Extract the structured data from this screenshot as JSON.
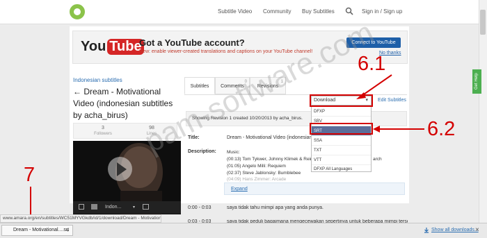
{
  "nav": {
    "links": [
      "Subtitle Video",
      "Community",
      "Buy Subtitles",
      "Sign in / Sign up"
    ]
  },
  "youtube_banner": {
    "logo_you": "You",
    "logo_tube": "Tube",
    "title": "Got a YouTube account?",
    "subtitle": "New: enable viewer-created translations and captions on your YouTube channel!",
    "connect_button": "Connect to YouTube",
    "no_thanks": "No thanks"
  },
  "video": {
    "language_link": "Indonesian subtitles",
    "title": "← Dream - Motivational Video (indonesian subtitles by acha_birus)",
    "followers_count": "3",
    "followers_label": "Followers",
    "lines_count": "98",
    "lines_label": "Lines",
    "bar_text": "Indon..."
  },
  "tabs": [
    {
      "label": "Subtitles",
      "count": ""
    },
    {
      "label": "Comments",
      "count": "0"
    },
    {
      "label": "Revisions",
      "count": "1"
    }
  ],
  "download": {
    "selected": "Download",
    "edit_link": "Edit Subtitles",
    "options": [
      "DFXP",
      "SBV",
      "SRT",
      "SSA",
      "TXT",
      "VTT",
      "DFXP All Languages"
    ]
  },
  "revision_info": "Showing Revision 1 created 10/20/2013 by acha_birus.",
  "details": {
    "title_label": "Title:",
    "title_value": "Dream - Motivational Video (indonesian subt",
    "desc_label": "Description:",
    "desc_lines": [
      "Music:",
      "(00:13) Tom Tykwer, Johnny Klimek & Rein",
      "(01:05) Angelo Milli: Requiem",
      "(02:37) Steve Jablonsky: Bumblebee",
      "(04:09) Hans Zimmer: Arcade"
    ],
    "desc_tail": "arch",
    "expand": "Expand"
  },
  "subtitle_rows": [
    {
      "time": "0:00 - 0:03",
      "text": "saya tidak tahu mimpi apa yang anda punya."
    },
    {
      "time": "0:03 - 0:03",
      "text": "saya tidak peduli bagaimana mengecewakan sepertinya untuk beberapa mimpi tersebut"
    }
  ],
  "watermark": "pam-software.com",
  "annotations": {
    "label_61": "6.1",
    "label_62": "6.2",
    "label_7": "7"
  },
  "feedback_tab": "Get Help",
  "status_url": "www.amara.org/en/subtitles/WC51MYVGkdb/id/1/download/Dream - Motivational...",
  "downloads": {
    "file": "Dream - Motivational....srt",
    "show_all": "Show all downloads..."
  }
}
